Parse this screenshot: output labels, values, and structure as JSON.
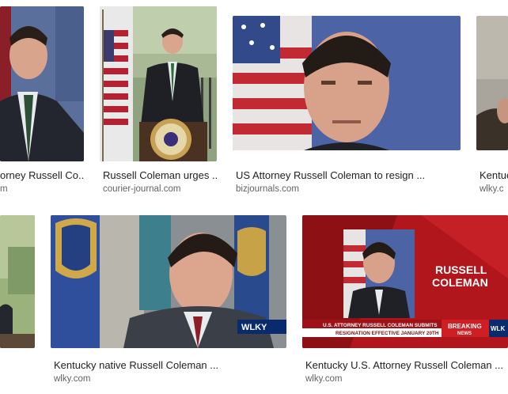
{
  "results": [
    {
      "title": "orney Russell Co...",
      "source": "m"
    },
    {
      "title": "Russell Coleman urges ...",
      "source": "courier-journal.com"
    },
    {
      "title": "US Attorney Russell Coleman to resign ...",
      "source": "bizjournals.com"
    },
    {
      "title": "Kentuc",
      "source": "wlky.c"
    },
    {
      "title": "",
      "source": ""
    },
    {
      "title": "Kentucky native Russell Coleman ...",
      "source": "wlky.com"
    },
    {
      "title": "Kentucky U.S. Attorney Russell Coleman ...",
      "source": "wlky.com"
    }
  ],
  "overlays": {
    "wlky_logo": "WLKY",
    "name_line1": "RUSSELL",
    "name_line2": "COLEMAN",
    "ticker": "U.S. ATTORNEY RUSSELL COLEMAN SUBMITS",
    "ticker2": "RESIGNATION EFFECTIVE JANUARY 20TH",
    "breaking1": "BREAKING",
    "breaking2": "NEWS",
    "wlky_small": "WLK"
  },
  "colors": {
    "title": "#202124",
    "source": "#5f6368",
    "news_red": "#b0161b"
  }
}
